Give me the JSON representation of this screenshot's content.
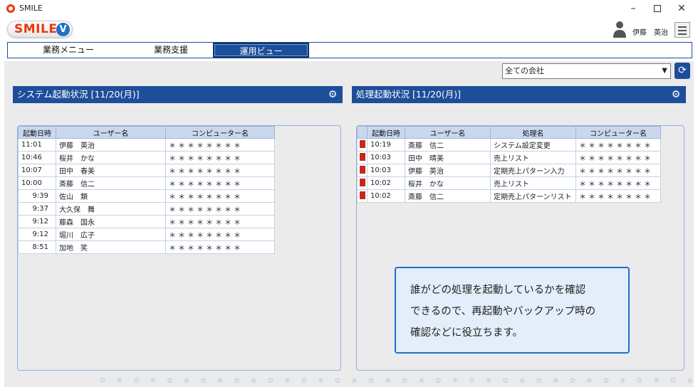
{
  "window": {
    "title": "SMILE"
  },
  "header": {
    "logo_text": "SMILE",
    "logo_mark": "V",
    "user_name": "伊藤　英治"
  },
  "tabs": [
    {
      "label": "業務メニュー"
    },
    {
      "label": "業務支援"
    },
    {
      "label": "運用ビュー"
    }
  ],
  "company_select": {
    "value": "全ての会社"
  },
  "left_panel": {
    "title": "システム起動状況 [11/20(月)]",
    "columns": [
      "起動日時",
      "ユーザー名",
      "コンピューター名"
    ],
    "rows": [
      {
        "time": "11:01",
        "user": "伊藤　英治",
        "computer": "＊＊＊＊＊＊＊＊"
      },
      {
        "time": "10:46",
        "user": "桜井　かな",
        "computer": "＊＊＊＊＊＊＊＊"
      },
      {
        "time": "10:07",
        "user": "田中　春美",
        "computer": "＊＊＊＊＊＊＊＊"
      },
      {
        "time": "10:00",
        "user": "斎藤　信二",
        "computer": "＊＊＊＊＊＊＊＊"
      },
      {
        "time": "9:39",
        "user": "佐山　類",
        "computer": "＊＊＊＊＊＊＊＊"
      },
      {
        "time": "9:37",
        "user": "大久保　舞",
        "computer": "＊＊＊＊＊＊＊＊"
      },
      {
        "time": "9:12",
        "user": "藤森　国永",
        "computer": "＊＊＊＊＊＊＊＊"
      },
      {
        "time": "9:12",
        "user": "堀川　広子",
        "computer": "＊＊＊＊＊＊＊＊"
      },
      {
        "time": "8:51",
        "user": "加地　笑",
        "computer": "＊＊＊＊＊＊＊＊"
      }
    ]
  },
  "right_panel": {
    "title": "処理起動状況 [11/20(月)]",
    "columns": [
      "起動日時",
      "ユーザー名",
      "処理名",
      "コンピューター名"
    ],
    "rows": [
      {
        "time": "10:19",
        "user": "斎藤　信二",
        "process": "システム設定変更",
        "computer": "＊＊＊＊＊＊＊＊"
      },
      {
        "time": "10:03",
        "user": "田中　晴美",
        "process": "売上リスト",
        "computer": "＊＊＊＊＊＊＊＊"
      },
      {
        "time": "10:03",
        "user": "伊藤　英治",
        "process": "定期売上パターン入力",
        "computer": "＊＊＊＊＊＊＊＊"
      },
      {
        "time": "10:02",
        "user": "桜井　かな",
        "process": "売上リスト",
        "computer": "＊＊＊＊＊＊＊＊"
      },
      {
        "time": "10:02",
        "user": "斎藤　信二",
        "process": "定期売上パターンリスト",
        "computer": "＊＊＊＊＊＊＊＊"
      }
    ]
  },
  "callout": {
    "lines": [
      "誰がどの処理を起動しているかを確認",
      "できるので、再起動やバックアップ時の",
      "確認などに役立ちます。"
    ]
  },
  "colors": {
    "accent": "#1d4e9a",
    "logo": "#e8380d",
    "flag": "#c7281c"
  }
}
